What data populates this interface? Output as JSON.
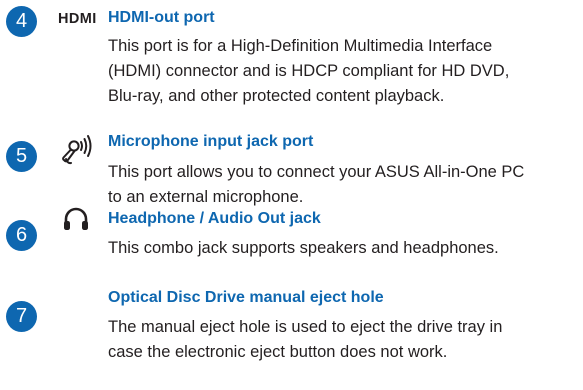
{
  "colors": {
    "accent": "#0e67b0",
    "text": "#231f20"
  },
  "entries": [
    {
      "number": "4",
      "icon": "hdmi-icon",
      "icon_text": "HDMI",
      "title": "HDMI-out port",
      "lines": [
        "This port is for a High-Definition Multimedia Interface",
        "(HDMI) connector and is HDCP compliant for HD DVD,",
        "Blu-ray, and other protected content playback."
      ]
    },
    {
      "number": "5",
      "icon": "microphone-icon",
      "title": "Microphone input jack port",
      "lines": [
        "This port allows you to connect your ASUS All-in-One PC",
        "to an external microphone."
      ]
    },
    {
      "number": "6",
      "icon": "headphone-icon",
      "title": "Headphone / Audio Out jack",
      "lines": [
        "This combo jack supports speakers and headphones."
      ]
    },
    {
      "number": "7",
      "icon": "",
      "title": "Optical Disc Drive manual eject hole",
      "lines": [
        "The manual eject hole is used to eject the drive tray in",
        "case the electronic eject button does not work."
      ]
    }
  ]
}
